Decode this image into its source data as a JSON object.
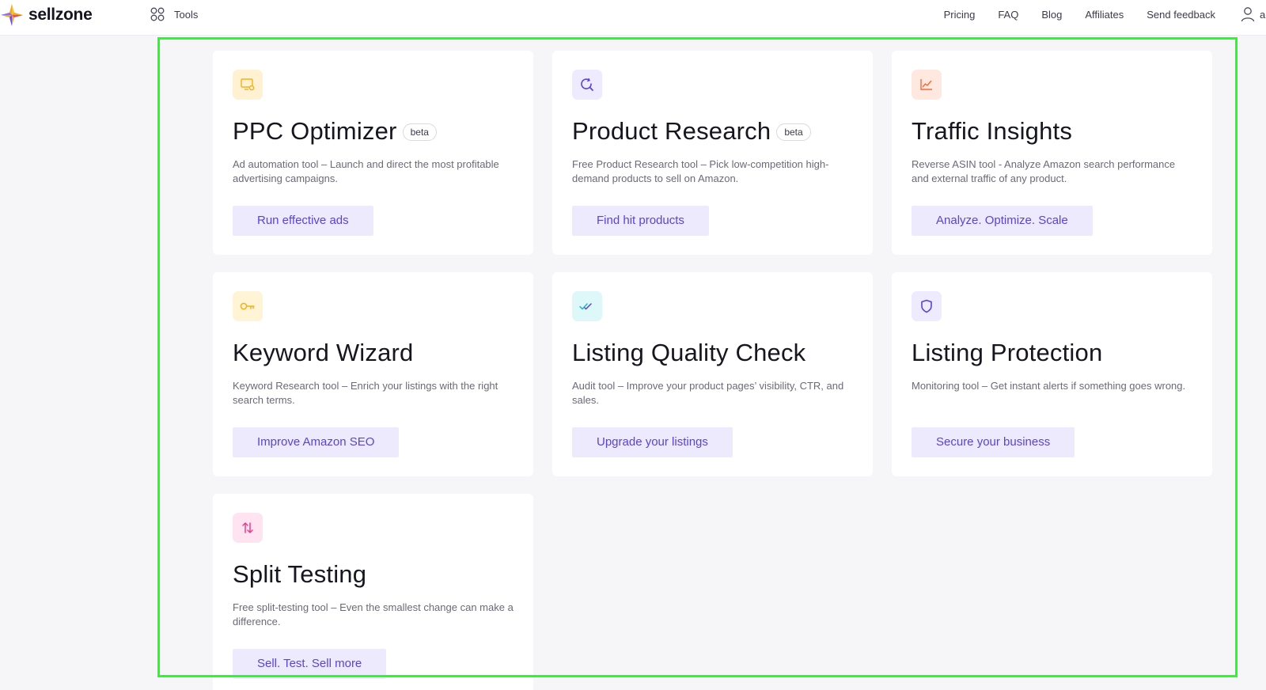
{
  "header": {
    "logo_text": "sellzone",
    "tools_label": "Tools",
    "links": [
      "Pricing",
      "FAQ",
      "Blog",
      "Affiliates",
      "Send feedback"
    ],
    "user_extra": "a"
  },
  "colors": {
    "accent": "#5b43d6",
    "button_bg": "#eeeafd",
    "highlight_frame": "#22ff22"
  },
  "cards": [
    {
      "title": "PPC Optimizer",
      "badge": "beta",
      "description": "Ad automation tool – Launch and direct the most profitable advertising campaigns.",
      "cta": "Run effective ads",
      "icon": "ppc-monitor-gear-icon",
      "icon_bg": "#fff1d2",
      "icon_color": "#f2b21b"
    },
    {
      "title": "Product Research",
      "badge": "beta",
      "description": "Free Product Research tool – Pick low-competition high-demand products to sell on Amazon.",
      "cta": "Find hit products",
      "icon": "search-refresh-icon",
      "icon_bg": "#eeeaff",
      "icon_color": "#5b43d6"
    },
    {
      "title": "Traffic Insights",
      "badge": "",
      "description": "Reverse ASIN tool - Analyze Amazon search performance and external traffic of any product.",
      "cta": "Analyze. Optimize. Scale",
      "icon": "line-chart-icon",
      "icon_bg": "#ffe8df",
      "icon_color": "#f26b3a"
    },
    {
      "title": "Keyword Wizard",
      "badge": "",
      "description": "Keyword Research tool – Enrich your listings with the right search terms.",
      "cta": "Improve Amazon SEO",
      "icon": "key-icon",
      "icon_bg": "#fff4d6",
      "icon_color": "#f2b21b"
    },
    {
      "title": "Listing Quality Check",
      "badge": "",
      "description": "Audit tool – Improve your product pages’ visibility, CTR, and sales.",
      "cta": "Upgrade your listings",
      "icon": "double-check-icon",
      "icon_bg": "#def8fa",
      "icon_color": "#1fb7c9"
    },
    {
      "title": "Listing Protection",
      "badge": "",
      "description": "Monitoring tool – Get instant alerts if something goes wrong.",
      "cta": "Secure your business",
      "icon": "shield-icon",
      "icon_bg": "#eeeaff",
      "icon_color": "#5b43d6"
    },
    {
      "title": "Split Testing",
      "badge": "",
      "description": "Free split-testing tool – Even the smallest change can make a difference.",
      "cta": "Sell. Test. Sell more",
      "icon": "up-down-arrows-icon",
      "icon_bg": "#ffe3f1",
      "icon_color": "#e83e8c"
    }
  ]
}
